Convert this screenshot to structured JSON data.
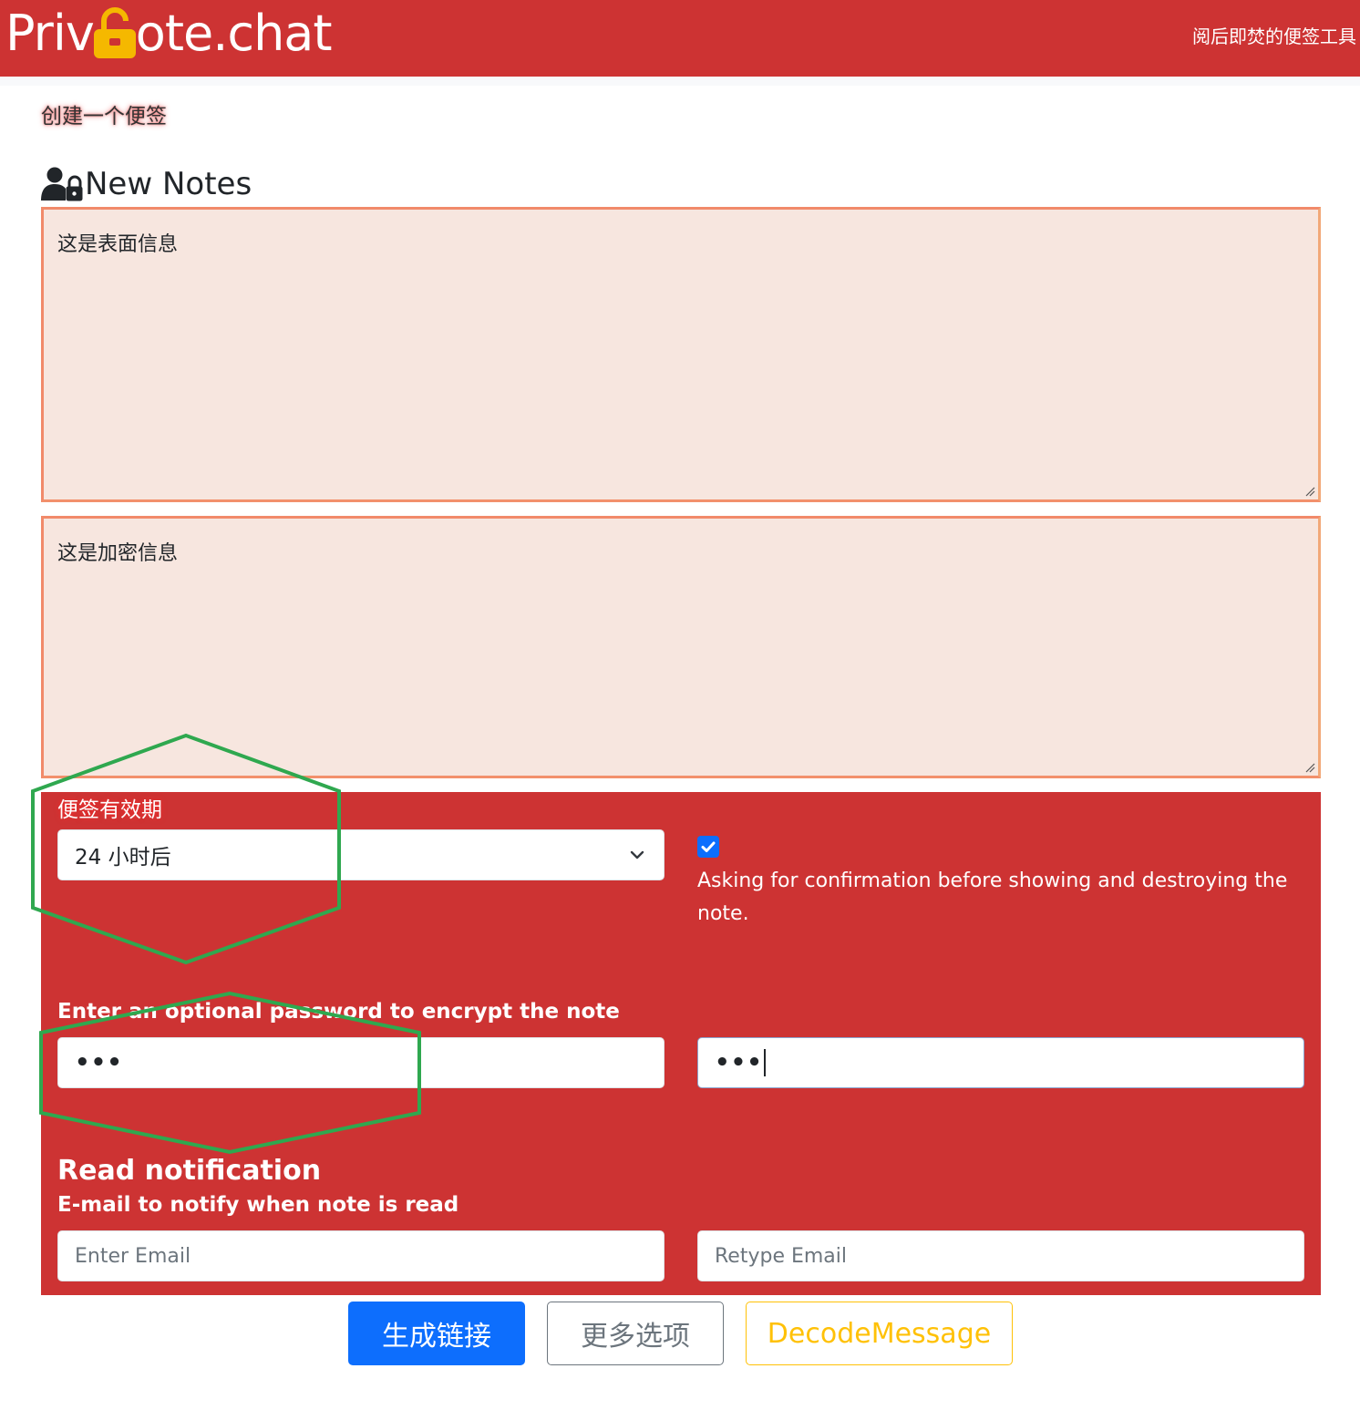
{
  "header": {
    "logo_left": "Priv",
    "logo_right": "ote.chat",
    "tagline": "阅后即焚的便签工具"
  },
  "page": {
    "subtitle": "创建一个便签",
    "section_title": "New Notes"
  },
  "notes": {
    "surface_text": "这是表面信息",
    "secret_text": "这是加密信息"
  },
  "options": {
    "expiry_label": "便签有效期",
    "expiry_selected": "24 小时后",
    "confirm_checked": true,
    "confirm_text": "Asking for confirmation before showing and destroying the note.",
    "password_label": "Enter an optional password to encrypt the note",
    "password_value": "•••",
    "password_confirm_value": "•••",
    "read_title": "Read notification",
    "read_sub": "E-mail to notify when note is read",
    "email_placeholder": "Enter Email",
    "email_retype_placeholder": "Retype Email"
  },
  "buttons": {
    "generate": "生成链接",
    "more": "更多选项",
    "decode": "DecodeMessage"
  },
  "colors": {
    "brand_red": "#cd3333",
    "lock_yellow": "#f5b800",
    "primary": "#0d6efd",
    "secondary": "#6c757d",
    "warning": "#ffc107",
    "note_bg": "#f7e6df",
    "note_border": "#f18a6a",
    "annotation_green": "#2fa84f"
  },
  "icons": {
    "logo_lock": "unlocked-padlock-icon",
    "section": "user-lock-icon",
    "select_arrow": "chevron-down-icon",
    "checkbox": "checkmark-icon",
    "resize": "resize-grip-icon"
  }
}
